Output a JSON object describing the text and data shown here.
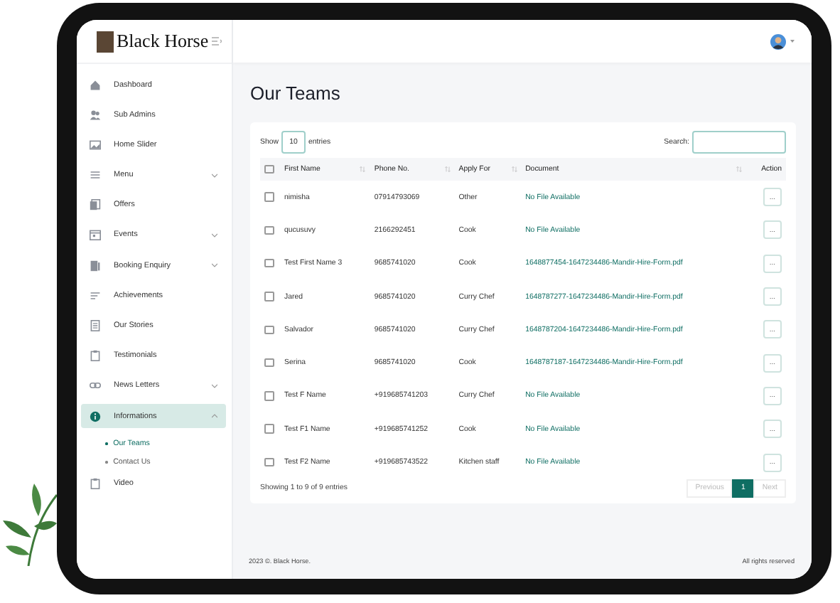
{
  "brand": {
    "name": "Black Horse"
  },
  "sidebar": {
    "items": [
      {
        "label": "Dashboard",
        "kind": "link",
        "selected": false
      },
      {
        "label": "Sub Admins",
        "kind": "link",
        "selected": false
      },
      {
        "label": "Home Slider",
        "kind": "link",
        "selected": false
      },
      {
        "label": "Menu",
        "kind": "group",
        "selected": false,
        "expanded": false
      },
      {
        "label": "Offers",
        "kind": "link",
        "selected": false
      },
      {
        "label": "Events",
        "kind": "group",
        "selected": false,
        "expanded": false
      },
      {
        "label": "Booking Enquiry",
        "kind": "group",
        "selected": false,
        "expanded": false
      },
      {
        "label": "Achievements",
        "kind": "link",
        "selected": false
      },
      {
        "label": "Our Stories",
        "kind": "link",
        "selected": false
      },
      {
        "label": "Testimonials",
        "kind": "link",
        "selected": false
      },
      {
        "label": "News Letters",
        "kind": "group",
        "selected": false,
        "expanded": false
      },
      {
        "label": "Informations",
        "kind": "group",
        "selected": true,
        "expanded": true,
        "children": [
          {
            "label": "Our Teams",
            "selected": true
          },
          {
            "label": "Contact Us",
            "selected": false
          }
        ]
      },
      {
        "label": "Video",
        "kind": "link",
        "selected": false
      }
    ]
  },
  "page": {
    "title": "Our Teams"
  },
  "table": {
    "show_label": "Show",
    "page_size": "10",
    "entries_label": "entries",
    "search_label": "Search:",
    "select_all_checked": false,
    "columns": [
      "First Name",
      "Phone No.",
      "Apply For",
      "Document",
      "Action"
    ],
    "rows": [
      {
        "checked": false,
        "first_name": "nimisha",
        "phone": "07914793069",
        "apply_for": "Other",
        "document": "No File Available",
        "action": "..."
      },
      {
        "checked": false,
        "first_name": "qucusuvy",
        "phone": "2166292451",
        "apply_for": "Cook",
        "document": "No File Available",
        "action": "..."
      },
      {
        "checked": false,
        "first_name": "Test First Name 3",
        "phone": "9685741020",
        "apply_for": "Cook",
        "document": "1648877454-1647234486-Mandir-Hire-Form.pdf",
        "action": "..."
      },
      {
        "checked": false,
        "first_name": "Jared",
        "phone": "9685741020",
        "apply_for": "Curry Chef",
        "document": "1648787277-1647234486-Mandir-Hire-Form.pdf",
        "action": "..."
      },
      {
        "checked": false,
        "first_name": "Salvador",
        "phone": "9685741020",
        "apply_for": "Curry Chef",
        "document": "1648787204-1647234486-Mandir-Hire-Form.pdf",
        "action": "..."
      },
      {
        "checked": false,
        "first_name": "Serina",
        "phone": "9685741020",
        "apply_for": "Cook",
        "document": "1648787187-1647234486-Mandir-Hire-Form.pdf",
        "action": "..."
      },
      {
        "checked": false,
        "first_name": "Test F Name",
        "phone": "+919685741203",
        "apply_for": "Curry Chef",
        "document": "No File Available",
        "action": "..."
      },
      {
        "checked": false,
        "first_name": "Test F1 Name",
        "phone": "+919685741252",
        "apply_for": "Cook",
        "document": "No File Available",
        "action": "..."
      },
      {
        "checked": false,
        "first_name": "Test F2 Name",
        "phone": "+919685743522",
        "apply_for": "Kitchen staff",
        "document": "No File Available",
        "action": "..."
      }
    ],
    "info": "Showing 1 to 9 of 9 entries",
    "pagination": [
      {
        "label": "Previous",
        "selected": false,
        "disabled": true
      },
      {
        "label": "1",
        "selected": true,
        "disabled": false
      },
      {
        "label": "Next",
        "selected": false,
        "disabled": true
      }
    ]
  },
  "footer": {
    "left": "2023 ©. Black Horse.",
    "right": "All rights reserved"
  }
}
